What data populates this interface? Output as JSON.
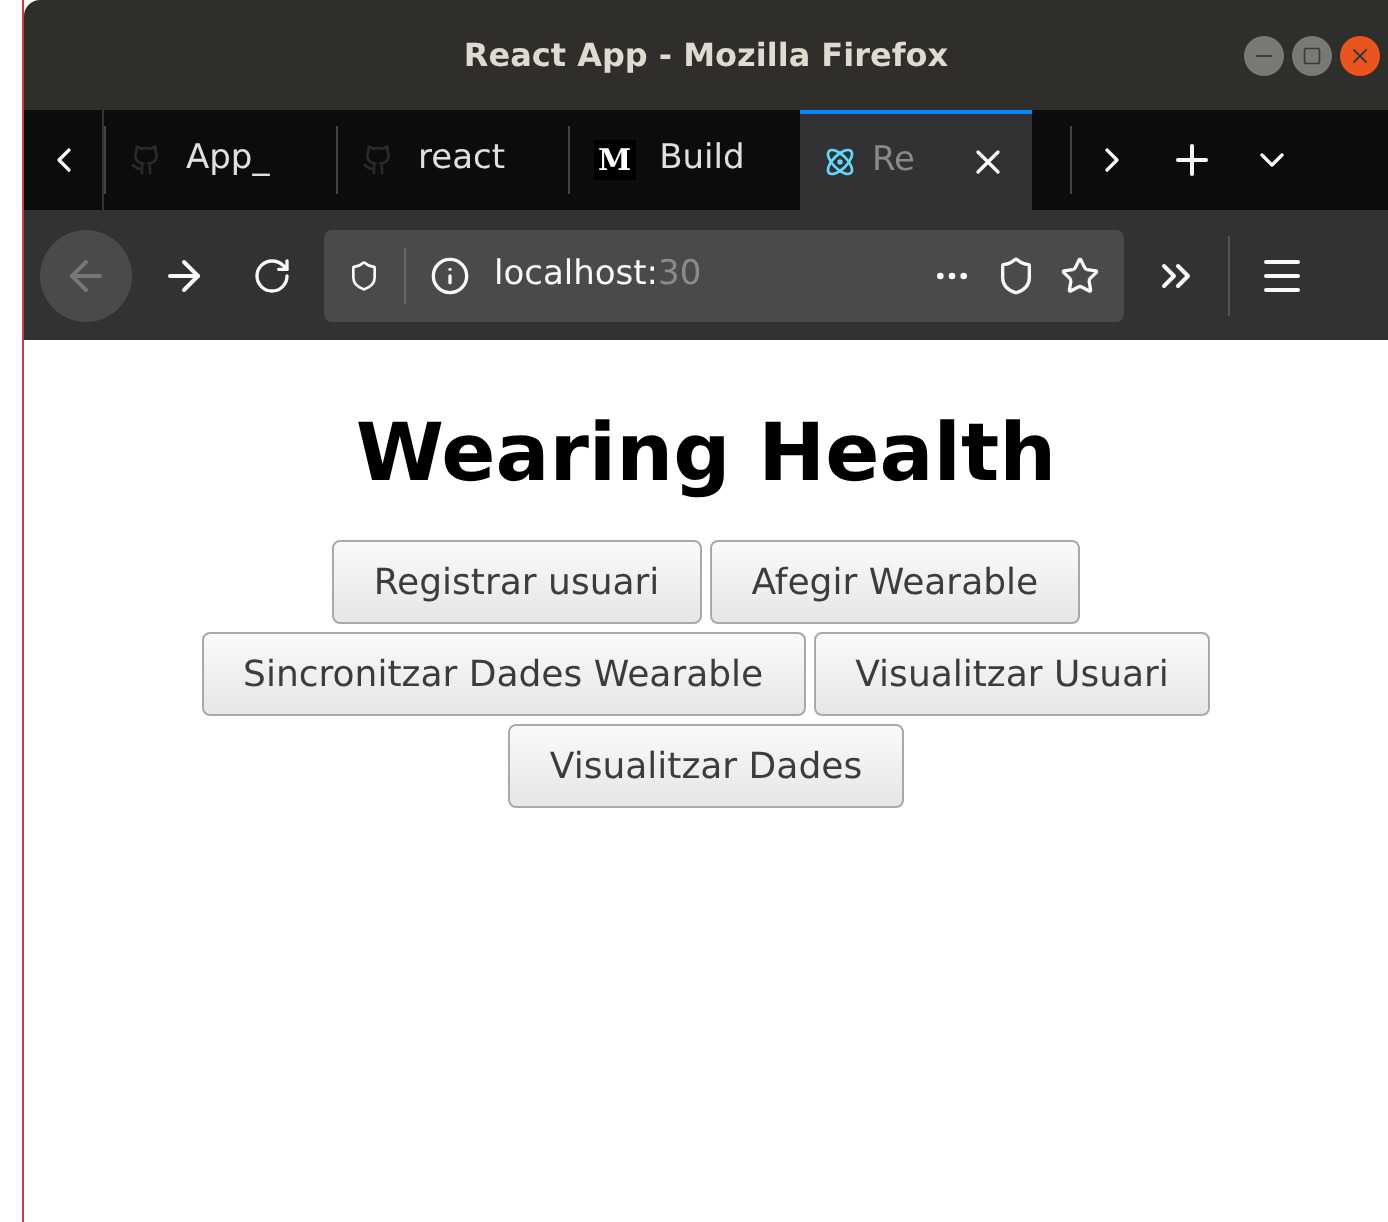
{
  "window": {
    "title": "React App - Mozilla Firefox"
  },
  "tabs": [
    {
      "label": "App_",
      "kind": "github",
      "selected": false
    },
    {
      "label": "react",
      "kind": "github",
      "selected": false
    },
    {
      "label": "Build",
      "kind": "medium",
      "logo": "M",
      "selected": false
    },
    {
      "label": "Re",
      "kind": "react",
      "selected": true
    }
  ],
  "address_bar": {
    "host": "localhost:",
    "port": "30"
  },
  "page": {
    "heading": "Wearing Health",
    "button_rows": [
      [
        "Registrar usuari",
        "Afegir Wearable"
      ],
      [
        "Sincronitzar Dades Wearable",
        "Visualitzar Usuari"
      ],
      [
        "Visualitzar Dades"
      ]
    ]
  }
}
